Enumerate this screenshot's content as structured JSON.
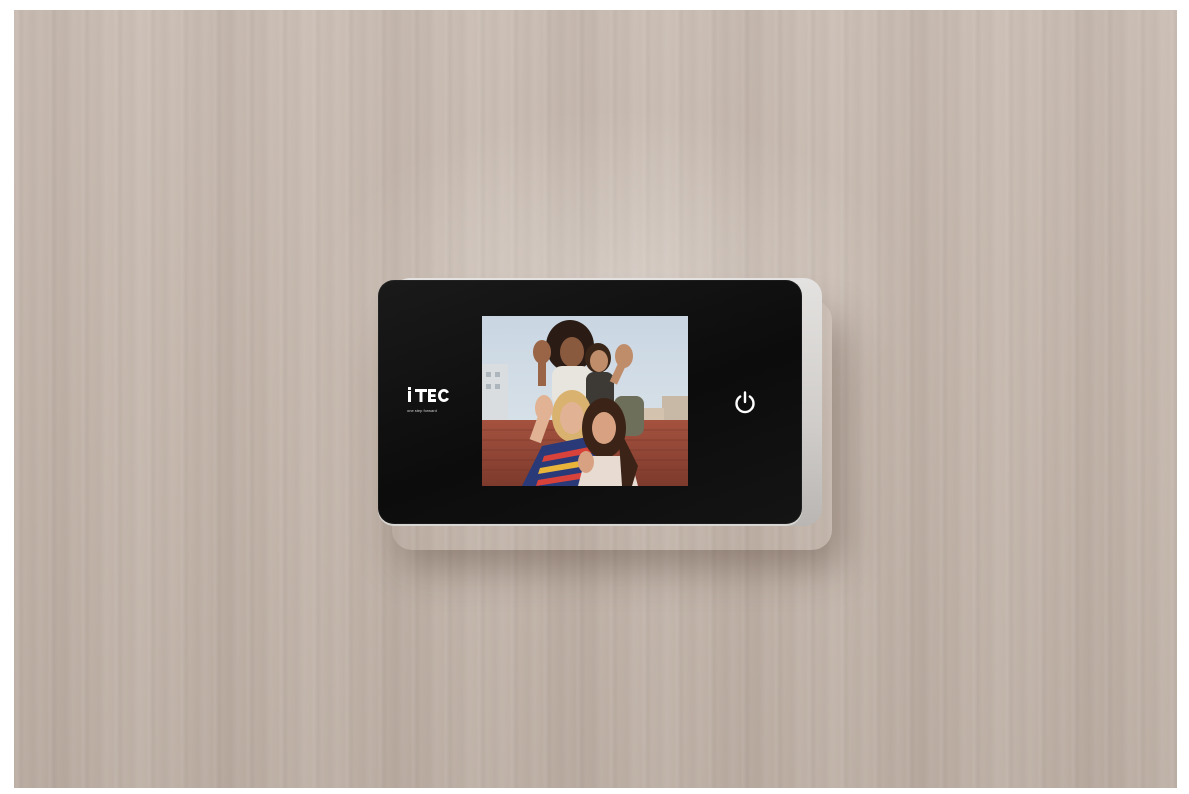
{
  "scene": {
    "description_tags": [
      "wood-wall",
      "digital-door-viewer",
      "display-screen"
    ]
  },
  "device": {
    "brand": "iTec",
    "brand_display": "i·Tec",
    "tagline": "one step forward",
    "power_icon": "power-icon",
    "screen_content": "photo-of-group-waving"
  },
  "colors": {
    "wall": "#c3b5aa",
    "device_face": "#111111",
    "device_frame": "#d6d3d0",
    "logo_text": "#ffffff"
  }
}
